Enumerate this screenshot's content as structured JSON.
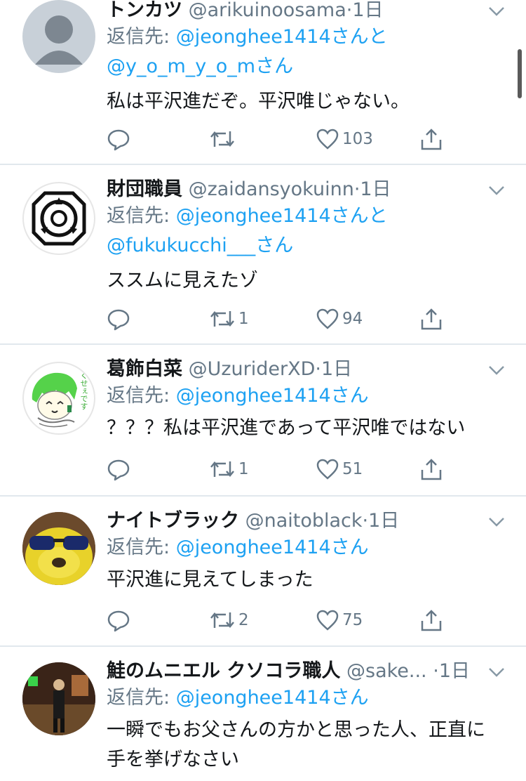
{
  "ui": {
    "time_label": "1日",
    "reply_prefix": "返信先: ",
    "san": "さん",
    "to": "と"
  },
  "tweets": [
    {
      "name": "トンカツ",
      "handle": "@arikuinoosama",
      "mention1": "@jeonghee1414",
      "mention2": "@y_o_m_y_o_m",
      "text_lines": [
        "私は平沢進だぞ。平沢唯じゃない。"
      ],
      "retweets": "",
      "likes": "103",
      "avatar": "default-avatar"
    },
    {
      "name": "財団職員",
      "handle": "@zaidansyokuinn",
      "mention1": "@jeonghee1414",
      "mention2": "@fukukucchi___",
      "text_lines": [
        "ススムに見えたゾ"
      ],
      "retweets": "1",
      "likes": "94",
      "avatar": "scp-logo-avatar"
    },
    {
      "name": "葛飾白菜",
      "handle": "@UzuriderXD",
      "mention1": "@jeonghee1414",
      "text_lines": [
        "？？？私は平沢進であって平沢唯ではない"
      ],
      "retweets": "1",
      "likes": "51",
      "avatar": "anime-drawing-avatar",
      "avatar_text": "くせぇです"
    },
    {
      "name": "ナイトブラック",
      "handle": "@naitoblack",
      "mention1": "@jeonghee1414",
      "text_lines": [
        "平沢進に見えてしまった"
      ],
      "retweets": "2",
      "likes": "75",
      "avatar": "plush-sunglasses-avatar"
    },
    {
      "name": "鮭のムニエル クソコラ職人",
      "handle": "@sake...",
      "mention1": "@jeonghee1414",
      "text_lines": [
        "一瞬でもお父さんの方かと思った人、正直に",
        "手を挙げなさい"
      ],
      "avatar": "stage-person-avatar"
    }
  ],
  "colors": {
    "link": "#1da1f2",
    "secondary": "#657786",
    "primary": "#14171a",
    "divider": "#e1e8ed"
  }
}
